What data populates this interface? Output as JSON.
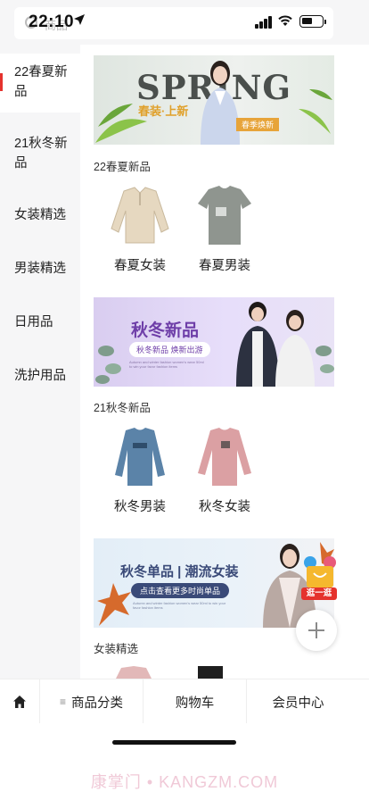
{
  "status_bar": {
    "time": "22:10"
  },
  "search": {
    "placeholder": "商品"
  },
  "sidebar": {
    "items": [
      {
        "label": "22春夏新品",
        "active": true
      },
      {
        "label": "21秋冬新品",
        "active": false
      },
      {
        "label": "女装精选",
        "active": false
      },
      {
        "label": "男装精选",
        "active": false
      },
      {
        "label": "日用品",
        "active": false
      },
      {
        "label": "洗护用品",
        "active": false
      }
    ]
  },
  "sections": [
    {
      "banner": {
        "headline": "SPRING",
        "subline": "春装·上新",
        "tag": "春季焕新"
      },
      "title": "22春夏新品",
      "products": [
        {
          "label": "春夏女装",
          "icon": "knit-sweater-image"
        },
        {
          "label": "春夏男装",
          "icon": "grey-tshirt-image"
        }
      ]
    },
    {
      "banner": {
        "headline": "秋冬新品",
        "subline": "秋冬新品 焕新出游",
        "fine_print": "Autumn and winter fashion women's wear 50ml to win your favor fashion items"
      },
      "title": "21秋冬新品",
      "products": [
        {
          "label": "秋冬男装",
          "icon": "blue-sweatshirt-image"
        },
        {
          "label": "秋冬女装",
          "icon": "pink-sweater-image"
        }
      ]
    },
    {
      "banner": {
        "headline": "秋冬单品 | 潮流女装",
        "subline": "点击查看更多时尚单品",
        "fine_print": "Autumn and winter fashion women's wear 50ml to win your favor fashion items"
      },
      "title": "女装精选",
      "products": []
    }
  ],
  "float_badge": {
    "label": "逛一逛"
  },
  "tabbar": {
    "items": [
      {
        "label": "",
        "icon": "home-icon"
      },
      {
        "label": "商品分类",
        "icon": "list-icon"
      },
      {
        "label": "购物车"
      },
      {
        "label": "会员中心"
      }
    ]
  },
  "watermark": "康掌门 • KANGZM.COM",
  "colors": {
    "accent": "#e5322d",
    "sidebar_bg": "#f6f6f7",
    "banner_purple": "#6e3ea8",
    "banner_navy": "#3a4a78"
  }
}
